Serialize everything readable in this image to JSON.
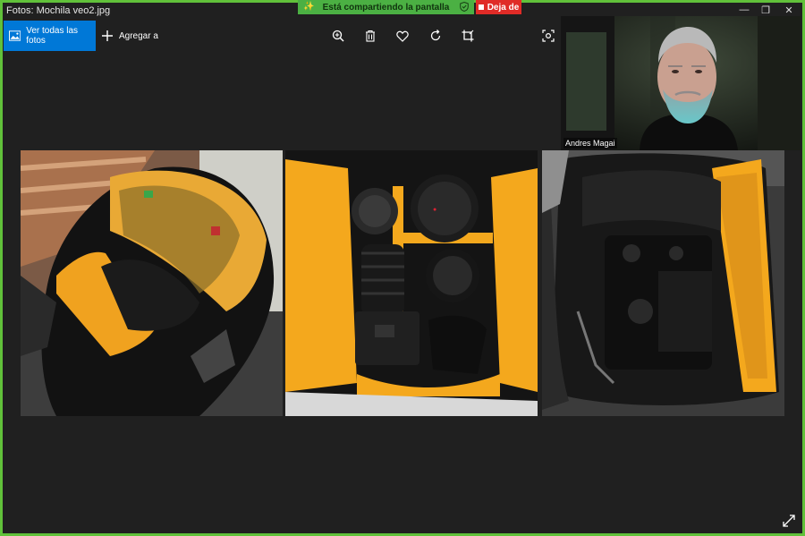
{
  "window": {
    "title": "Fotos: Mochila veo2.jpg",
    "controls": {
      "minimize": "—",
      "restore": "❐",
      "close": "✕"
    }
  },
  "screen_share": {
    "status": "Está compartiendo la pantalla",
    "stop_label": "Deja de",
    "accent_color": "#4bb043",
    "stop_color": "#e02b27"
  },
  "toolbar": {
    "view_all_label": "Ver todas las fotos",
    "add_label": "Agregar a",
    "tools": [
      "zoom-in-icon",
      "delete-icon",
      "favorite-icon",
      "rotate-icon",
      "crop-icon",
      "visual-search-icon"
    ]
  },
  "webcam": {
    "participant_name": "Andres Magai"
  },
  "photos": [
    {
      "name": "backpack-open-front"
    },
    {
      "name": "backpack-lenses-camera"
    },
    {
      "name": "backpack-camera-side"
    }
  ],
  "colors": {
    "window_border": "#61c13a",
    "accent_blue": "#0078d7",
    "background": "#202020",
    "padding_yellow": "#f4a81d"
  }
}
